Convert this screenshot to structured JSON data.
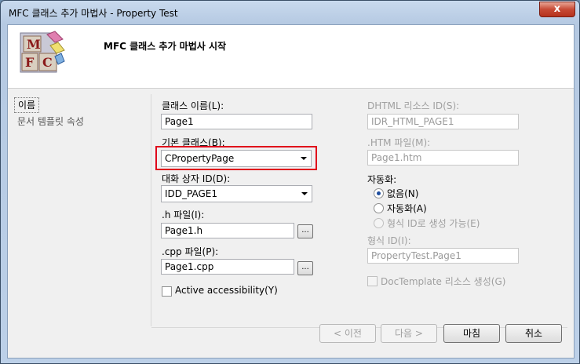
{
  "window": {
    "title": "MFC 클래스 추가 마법사 - Property Test",
    "close": "x"
  },
  "header": {
    "title": "MFC 클래스 추가 마법사 시작",
    "logo_letters": [
      "M",
      "F",
      "C"
    ]
  },
  "nav": {
    "items": [
      {
        "label": "이름",
        "selected": true
      },
      {
        "label": "문서 템플릿 속성",
        "selected": false
      }
    ]
  },
  "form": {
    "class_name_label": "클래스 이름(L):",
    "class_name_value": "Page1",
    "base_class_label": "기본 클래스(B):",
    "base_class_value": "CPropertyPage",
    "dialog_id_label": "대화 상자 ID(D):",
    "dialog_id_value": "IDD_PAGE1",
    "h_file_label": ".h 파일(I):",
    "h_file_value": "Page1.h",
    "cpp_file_label": ".cpp 파일(P):",
    "cpp_file_value": "Page1.cpp",
    "browse_label": "...",
    "active_accessibility_label": "Active accessibility(Y)",
    "dhtml_id_label": "DHTML 리소스 ID(S):",
    "dhtml_id_value": "IDR_HTML_PAGE1",
    "htm_file_label": ".HTM 파일(M):",
    "htm_file_value": "Page1.htm",
    "automation_label": "자동화:",
    "radio_none": "없음(N)",
    "radio_automation": "자동화(A)",
    "radio_typeid": "형식 ID로 생성 가능(E)",
    "type_id_label": "형식 ID(I):",
    "type_id_value": "PropertyTest.Page1",
    "doctemplate_label": "DocTemplate 리소스 생성(G)"
  },
  "buttons": {
    "prev": "< 이전",
    "next": "다음 >",
    "finish": "마침",
    "cancel": "취소"
  },
  "colors": {
    "highlight_box": "#e0001a"
  }
}
